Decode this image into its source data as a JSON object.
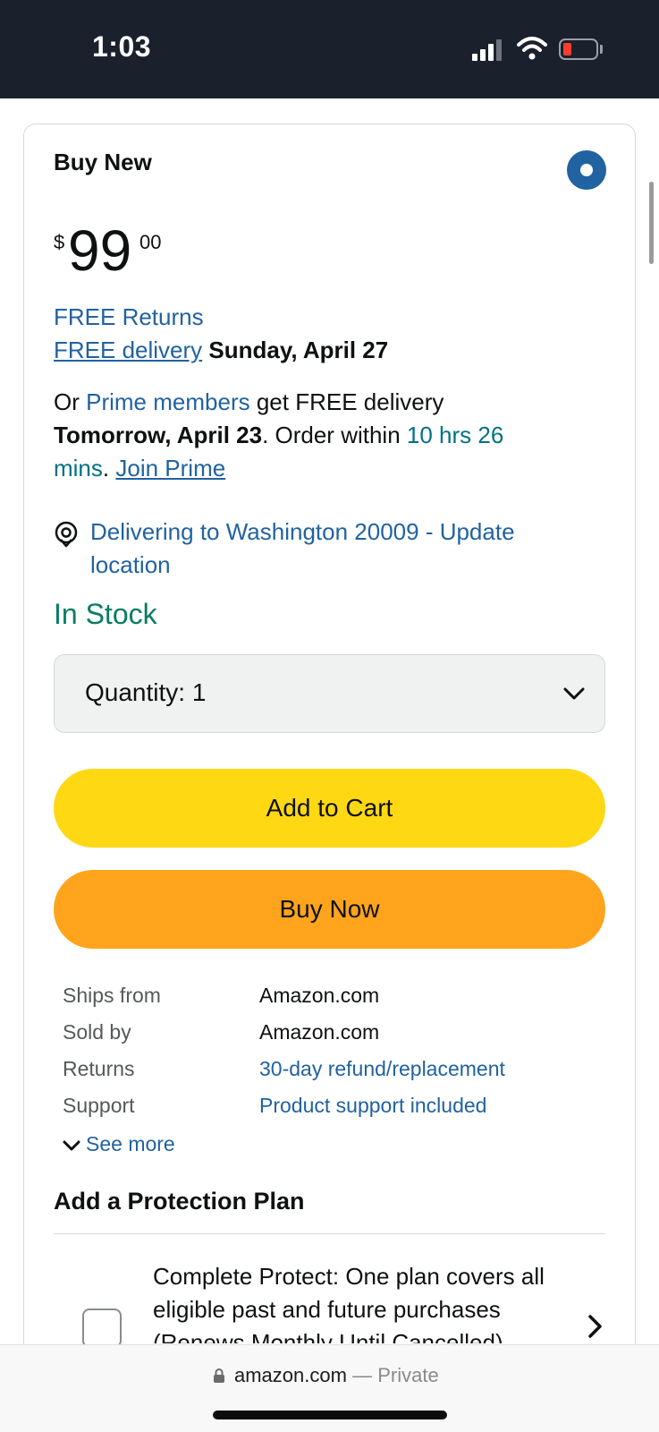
{
  "status_bar": {
    "time": "1:03",
    "icons": [
      "cellular-signal-icon",
      "wifi-icon",
      "battery-low-icon"
    ]
  },
  "offer": {
    "heading": "Buy New",
    "price": {
      "symbol": "$",
      "whole": "99",
      "fraction": "00"
    },
    "free_returns": "FREE Returns",
    "free_delivery_link": "FREE delivery",
    "free_delivery_date": "Sunday, April 27",
    "prime": {
      "or": "Or",
      "members_link": "Prime members",
      "rest": "get FREE delivery",
      "date": "Tomorrow, April 23",
      "order_within": ". Order within",
      "countdown_a": "10 hrs 26",
      "countdown_b": "mins",
      "dot": ".",
      "join_link": "Join Prime"
    },
    "location": {
      "line1": "Delivering to Washington 20009 - Update",
      "line2": "location"
    },
    "stock": "In Stock",
    "quantity": {
      "label": "Quantity:",
      "value": "1"
    },
    "add_to_cart": "Add to Cart",
    "buy_now": "Buy Now"
  },
  "details": [
    {
      "label": "Ships from",
      "value": "Amazon.com"
    },
    {
      "label": "Sold by",
      "value": "Amazon.com"
    },
    {
      "label": "Returns",
      "value": "30-day refund/replacement"
    },
    {
      "label": "Support",
      "value": "Product support included"
    }
  ],
  "see_more": "See more",
  "protection": {
    "title": "Add a Protection Plan",
    "plan_text": "Complete Protect: One plan covers all eligible past and future purchases (Renews Monthly Until Cancelled)"
  },
  "browser": {
    "domain": "amazon.com",
    "separator": "—",
    "mode": "Private"
  },
  "colors": {
    "link": "#2162a1",
    "teal": "#007185",
    "in_stock": "#067d62",
    "add_to_cart": "#ffd814",
    "buy_now": "#ffa41c",
    "radio_selected": "#2162a1"
  }
}
